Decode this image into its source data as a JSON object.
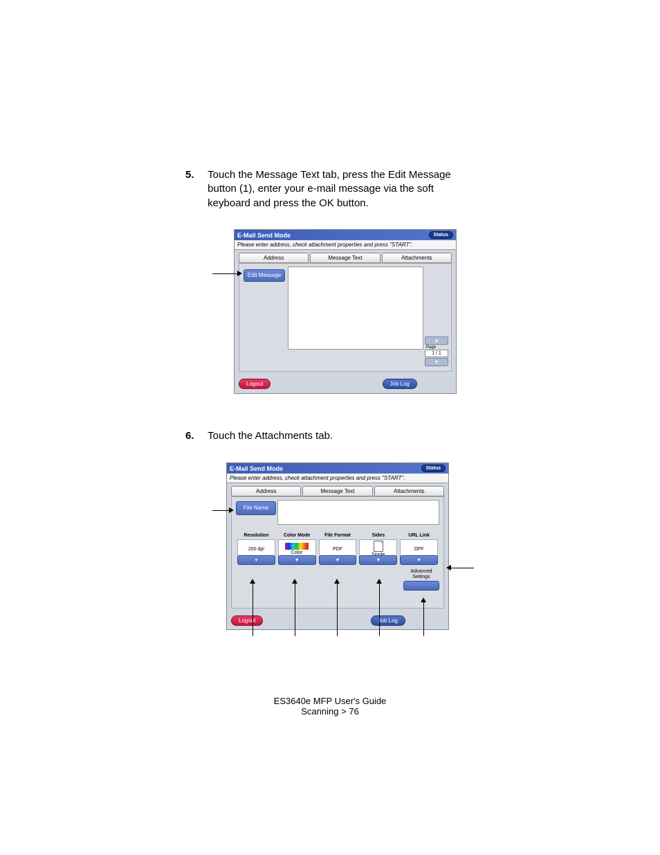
{
  "steps": {
    "s5": {
      "num": "5.",
      "text": "Touch the Message Text tab, press the Edit Message button (1), enter your e-mail message via the soft keyboard and press the OK button."
    },
    "s6": {
      "num": "6.",
      "text": "Touch the Attachments tab."
    }
  },
  "screen1": {
    "title": "E-Mail Send Mode",
    "status": "Status",
    "instruction": "Please enter address, check attachment properties and press \"START\".",
    "tabs": [
      "Address",
      "Message Text",
      "Attachments"
    ],
    "editMessage": "Edit Message",
    "pageLabel": "Page",
    "pageValue": "1 / 1 ",
    "logout": "Logout",
    "joblog": "Job Log"
  },
  "screen2": {
    "title": "E-Mail Send Mode",
    "status": "Status",
    "instruction": "Please enter address, check attachment properties and press \"START\".",
    "tabs": [
      "Address",
      "Message Text",
      "Attachments"
    ],
    "fileName": "File Name",
    "opts": [
      {
        "label": "Resolution",
        "value": "200 dpi"
      },
      {
        "label": "Color Mode",
        "value": "Color"
      },
      {
        "label": "File Format",
        "value": "PDF"
      },
      {
        "label": "Sides",
        "value": "Single"
      },
      {
        "label": "URL Link",
        "value": "OFF"
      }
    ],
    "advanced": "Advanced\nSettings",
    "logout": "Logout",
    "joblog": "Job Log"
  },
  "footer": {
    "line1": "ES3640e MFP User's Guide",
    "line2": "Scanning > 76"
  }
}
